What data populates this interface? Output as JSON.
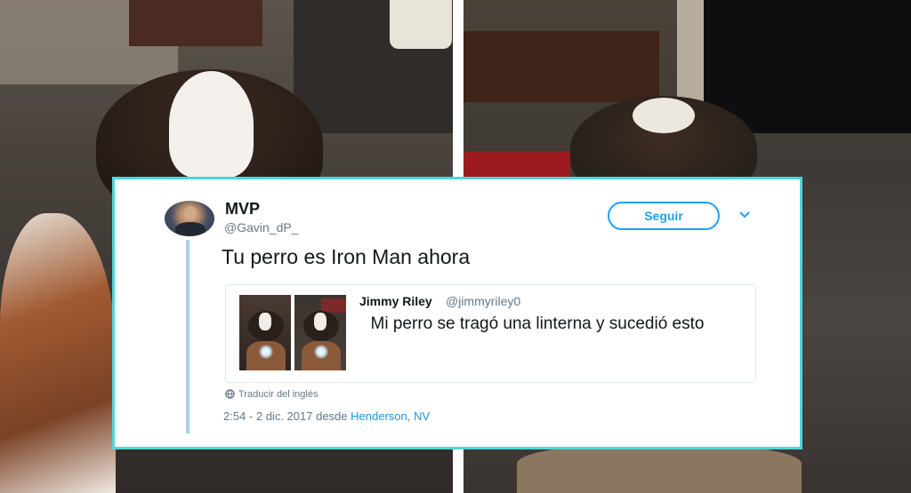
{
  "tweet": {
    "author": {
      "name": "MVP",
      "handle": "@Gavin_dP_"
    },
    "follow_label": "Seguir",
    "text": "Tu perro es Iron Man ahora",
    "quoted": {
      "name": "Jimmy Riley",
      "handle": "@jimmyriley0",
      "text": "Mi perro se tragó una linterna y sucedió esto"
    },
    "translate_label": "Traducir del inglés",
    "timestamp": "2:54 - 2 dic. 2017",
    "from_label": "desde",
    "location": "Henderson, NV"
  },
  "colors": {
    "accent": "#1da1f2",
    "card_border": "#4fd6d6",
    "thread_line": "#a3d3f2",
    "link": "#1b95e0"
  }
}
